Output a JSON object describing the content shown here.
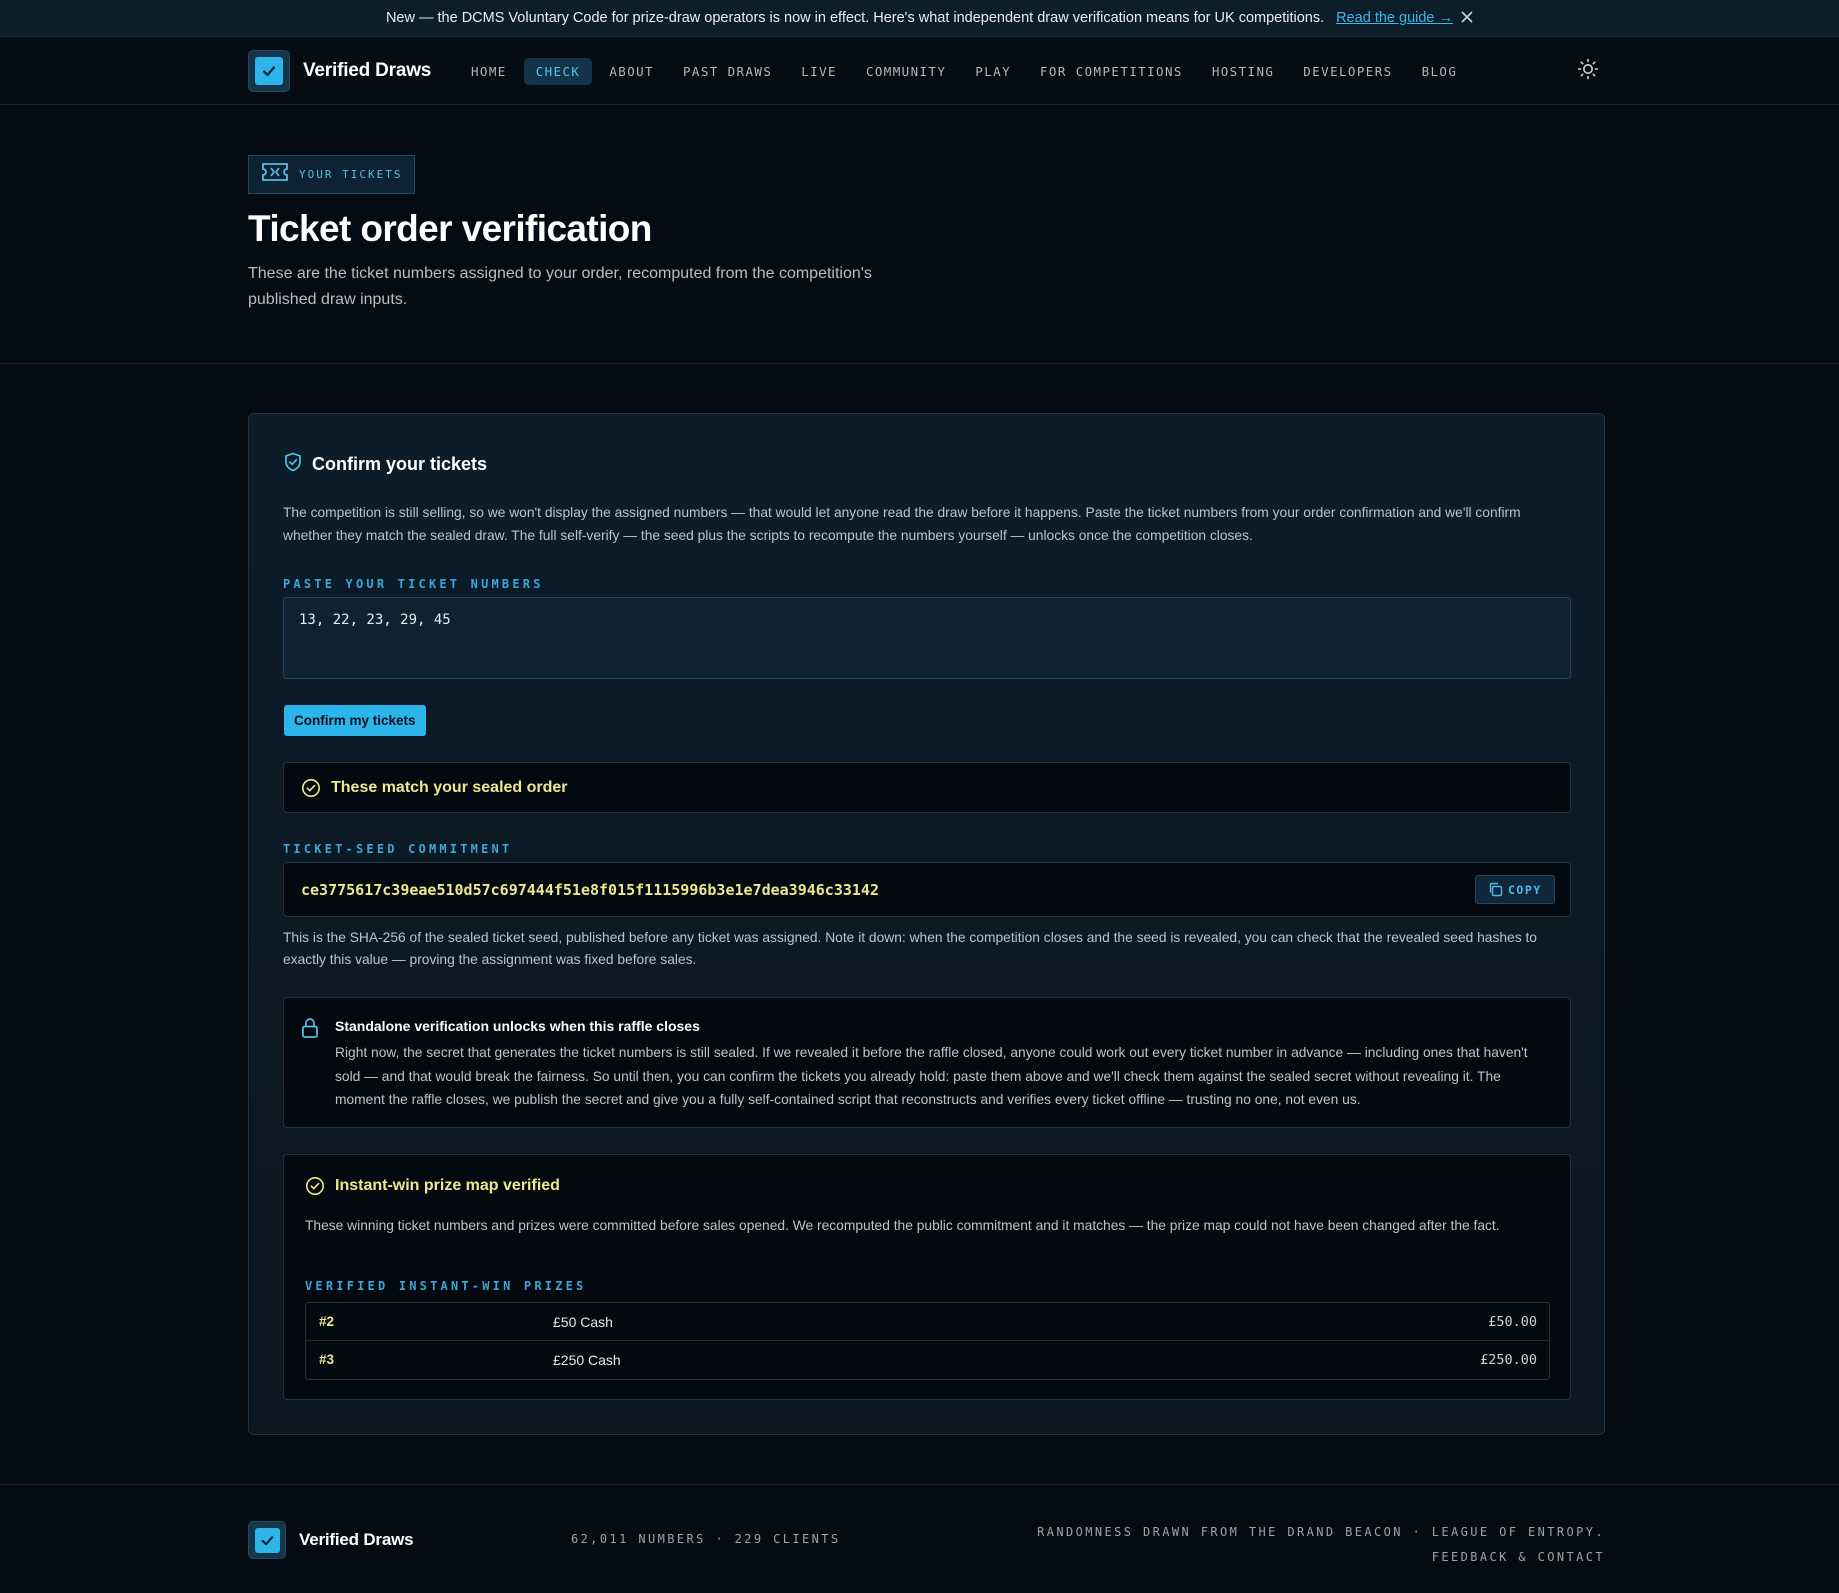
{
  "announcement": {
    "message": "New — the DCMS Voluntary Code for prize-draw operators is now in effect. Here's what independent draw verification means for UK competitions.",
    "link_label": "Read the guide →"
  },
  "brand": {
    "name": "Verified Draws"
  },
  "nav": {
    "items": [
      {
        "label": "HOME"
      },
      {
        "label": "CHECK"
      },
      {
        "label": "ABOUT"
      },
      {
        "label": "PAST DRAWS"
      },
      {
        "label": "LIVE"
      },
      {
        "label": "COMMUNITY"
      },
      {
        "label": "PLAY"
      },
      {
        "label": "FOR COMPETITIONS"
      },
      {
        "label": "HOSTING"
      },
      {
        "label": "DEVELOPERS"
      },
      {
        "label": "BLOG"
      }
    ],
    "active": "CHECK"
  },
  "hero": {
    "tag": "YOUR TICKETS",
    "title": "Ticket order verification",
    "subtitle": "These are the ticket numbers assigned to your order, recomputed from the competition's published draw inputs."
  },
  "card": {
    "title": "Confirm your tickets",
    "description": "The competition is still selling, so we won't display the assigned numbers — that would let anyone read the draw before it happens. Paste the ticket numbers from your order confirmation and we'll confirm whether they match the sealed draw. The full self-verify — the seed plus the scripts to recompute the numbers yourself — unlocks once the competition closes.",
    "input_label": "PASTE YOUR TICKET NUMBERS",
    "input_value": "13, 22, 23, 29, 45",
    "confirm_button": "Confirm my tickets",
    "match_result": "These match your sealed order",
    "commitment_label": "TICKET-SEED COMMITMENT",
    "commitment_hash": "ce3775617c39eae510d57c697444f51e8f015f1115996b3e1e7dea3946c33142",
    "copy_label": "COPY",
    "commitment_note": "This is the SHA-256 of the sealed ticket seed, published before any ticket was assigned. Note it down: when the competition closes and the seed is revealed, you can check that the revealed seed hashes to exactly this value — proving the assignment was fixed before sales.",
    "lock": {
      "title": "Standalone verification unlocks when this raffle closes",
      "body": "Right now, the secret that generates the ticket numbers is still sealed. If we revealed it before the raffle closed, anyone could work out every ticket number in advance — including ones that haven't sold — and that would break the fairness. So until then, you can confirm the tickets you already hold: paste them above and we'll check them against the sealed secret without revealing it. The moment the raffle closes, we publish the secret and give you a fully self-contained script that reconstructs and verifies every ticket offline — trusting no one, not even us."
    },
    "prize_map": {
      "title": "Instant-win prize map verified",
      "description": "These winning ticket numbers and prizes were committed before sales opened. We recomputed the public commitment and it matches — the prize map could not have been changed after the fact.",
      "table_label": "VERIFIED INSTANT-WIN PRIZES",
      "rows": [
        {
          "number": "#2",
          "prize": "£50 Cash",
          "amount": "£50.00"
        },
        {
          "number": "#3",
          "prize": "£250 Cash",
          "amount": "£250.00"
        }
      ]
    }
  },
  "footer": {
    "brand": "Verified Draws",
    "stats": "62,011 NUMBERS · 229 CLIENTS",
    "randomness": "RANDOMNESS DRAWN FROM THE DRAND BEACON · LEAGUE OF ENTROPY.",
    "feedback": "FEEDBACK & CONTACT"
  },
  "colors": {
    "accent": "#2bb5ea",
    "success_text": "#ece88f",
    "background": "#050b12"
  }
}
